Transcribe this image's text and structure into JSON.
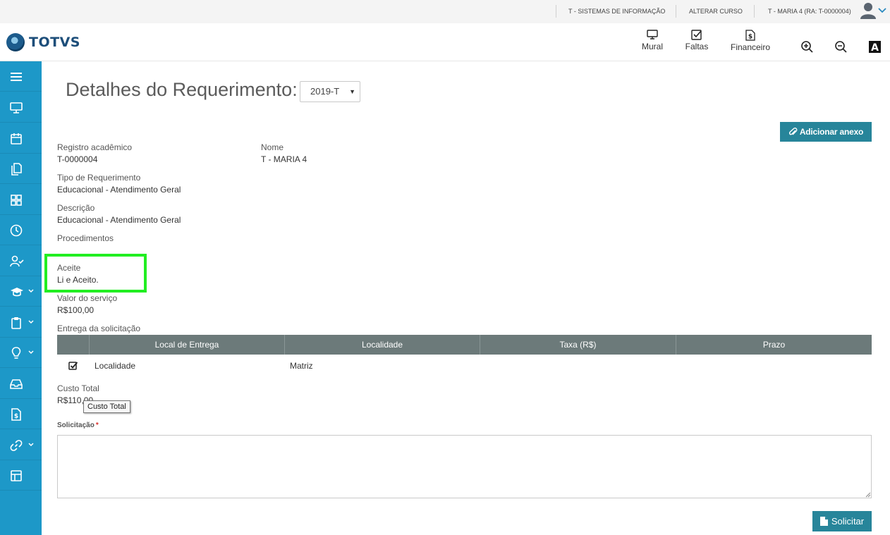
{
  "topbar": {
    "course": "T - SISTEMAS DE INFORMAÇÃO",
    "change_course": "ALTERAR CURSO",
    "user": "T - MARIA 4 (RA: T-0000004)"
  },
  "header": {
    "logo_text": "TOTVS",
    "nav": [
      {
        "label": "Mural",
        "icon": "monitor-icon"
      },
      {
        "label": "Faltas",
        "icon": "checkbox-icon"
      },
      {
        "label": "Financeiro",
        "icon": "dollar-document-icon"
      }
    ],
    "tools": [
      "zoom-in-icon",
      "zoom-out-icon",
      "contrast-icon"
    ]
  },
  "sidebar": {
    "items": [
      {
        "icon": "menu-icon",
        "has_caret": false
      },
      {
        "icon": "monitor-icon",
        "has_caret": false
      },
      {
        "icon": "calendar-icon",
        "has_caret": false
      },
      {
        "icon": "documents-icon",
        "has_caret": false
      },
      {
        "icon": "grid-icon",
        "has_caret": false
      },
      {
        "icon": "clock-icon",
        "has_caret": false
      },
      {
        "icon": "user-check-icon",
        "has_caret": false
      },
      {
        "icon": "graduation-cap-icon",
        "has_caret": true
      },
      {
        "icon": "clipboard-icon",
        "has_caret": true
      },
      {
        "icon": "lightbulb-icon",
        "has_caret": true
      },
      {
        "icon": "inbox-icon",
        "has_caret": false
      },
      {
        "icon": "dollar-document-icon",
        "has_caret": false
      },
      {
        "icon": "link-icon",
        "has_caret": true
      },
      {
        "icon": "layout-icon",
        "has_caret": false
      }
    ]
  },
  "page": {
    "title": "Detalhes do Requerimento:",
    "period_select": "2019-T",
    "attach_button": "Adicionar anexo"
  },
  "details": {
    "registro_label": "Registro acadêmico",
    "registro_value": "T-0000004",
    "nome_label": "Nome",
    "nome_value": "T - MARIA 4",
    "tipo_label": "Tipo de Requerimento",
    "tipo_value": "Educacional - Atendimento Geral",
    "descricao_label": "Descrição",
    "descricao_value": "Educacional - Atendimento Geral",
    "procedimentos_label": "Procedimentos",
    "aceite_label": "Aceite",
    "aceite_value": "Li e Aceito.",
    "valor_label": "Valor do serviço",
    "valor_value": "R$100,00",
    "entrega_label": "Entrega da solicitação",
    "custo_label": "Custo Total",
    "custo_value": "R$110,00"
  },
  "table": {
    "headers": [
      "Local de Entrega",
      "Localidade",
      "Taxa (R$)",
      "Prazo"
    ],
    "rows": [
      {
        "checked": true,
        "local": "Localidade",
        "localidade": "Matriz",
        "taxa": "",
        "prazo": ""
      }
    ]
  },
  "tooltip": "Custo Total",
  "form": {
    "solicitacao_label": "Solicitação",
    "required_mark": "*",
    "textarea_value": "",
    "submit_label": "Solicitar"
  },
  "colors": {
    "sidebar": "#1d98c8",
    "button": "#27859a",
    "table_header": "#6c7a7a",
    "highlight": "#22ee22"
  }
}
